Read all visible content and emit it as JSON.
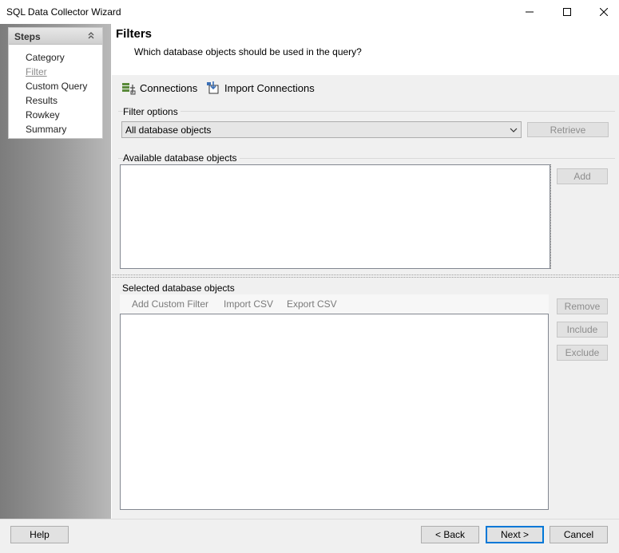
{
  "window": {
    "title": "SQL Data Collector Wizard"
  },
  "steps": {
    "header": "Steps",
    "items": [
      {
        "label": "Category",
        "active": false
      },
      {
        "label": "Filter",
        "active": true
      },
      {
        "label": "Custom Query",
        "active": false
      },
      {
        "label": "Results",
        "active": false
      },
      {
        "label": "Rowkey",
        "active": false
      },
      {
        "label": "Summary",
        "active": false
      }
    ]
  },
  "page": {
    "title": "Filters",
    "subtitle": "Which database objects should be used in the query?"
  },
  "toolbar": {
    "connections": "Connections",
    "import_connections": "Import Connections"
  },
  "filter_options": {
    "label": "Filter options",
    "selected": "All database objects",
    "retrieve": "Retrieve"
  },
  "available": {
    "label": "Available database objects",
    "add": "Add"
  },
  "selected": {
    "label": "Selected database objects",
    "add_custom_filter": "Add Custom Filter",
    "import_csv": "Import CSV",
    "export_csv": "Export CSV",
    "remove": "Remove",
    "include": "Include",
    "exclude": "Exclude"
  },
  "footer": {
    "help": "Help",
    "back": "< Back",
    "next": "Next >",
    "cancel": "Cancel"
  },
  "colors": {
    "accent": "#0078d7",
    "disabled_text": "#8d8d8d"
  }
}
